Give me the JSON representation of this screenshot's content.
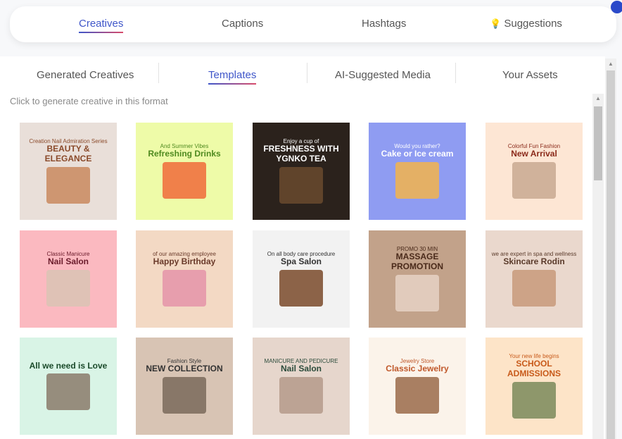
{
  "top_tabs": [
    {
      "label": "Creatives",
      "active": true
    },
    {
      "label": "Captions"
    },
    {
      "label": "Hashtags"
    },
    {
      "label": "Suggestions",
      "icon": "lightbulb-icon"
    }
  ],
  "sub_tabs": [
    {
      "label": "Generated Creatives"
    },
    {
      "label": "Templates",
      "active": true
    },
    {
      "label": "AI-Suggested Media"
    },
    {
      "label": "Your Assets"
    }
  ],
  "hint": "Click to generate creative in this format",
  "accent": "#3f56c9",
  "templates": [
    {
      "title": "BEAUTY & ELEGANCE",
      "sub": "Creation Nail Admiration Series",
      "bg": "#e9dfd9",
      "fg": "#8a4a2a",
      "ph": "#c98a5e"
    },
    {
      "title": "Refreshing Drinks",
      "sub": "And Summer Vibes",
      "bg": "#eefba8",
      "fg": "#4f8a1f",
      "ph": "#f06a3a"
    },
    {
      "title": "FRESHNESS WITH YGNKO TEA",
      "sub": "Enjoy a cup of",
      "bg": "#2b221c",
      "fg": "#ffffff",
      "ph": "#6a4a2e"
    },
    {
      "title": "Cake or Ice cream",
      "sub": "Would you rather?",
      "bg": "#8f9cf2",
      "fg": "#ffffff",
      "ph": "#f3b44c"
    },
    {
      "title": "New Arrival",
      "sub": "Colorful Fun Fashion",
      "bg": "#fde6d4",
      "fg": "#8a2a1a",
      "ph": "#c8a890"
    },
    {
      "title": "Nail Salon",
      "sub": "Classic Manicure",
      "bg": "#fbb9c0",
      "fg": "#6a1a2a",
      "ph": "#d9c3b4"
    },
    {
      "title": "Happy Birthday",
      "sub": "of our amazing employee",
      "bg": "#f3d9c4",
      "fg": "#6a3a2a",
      "ph": "#e493a9"
    },
    {
      "title": "Spa Salon",
      "sub": "On all body care procedure",
      "bg": "#f2f2f2",
      "fg": "#333333",
      "ph": "#7a4a2a"
    },
    {
      "title": "MASSAGE PROMOTION",
      "sub": "PROMO 30 MIN",
      "bg": "#c2a28a",
      "fg": "#4a2a1a",
      "ph": "#e6d2c4"
    },
    {
      "title": "Skincare Rodin",
      "sub": "we are expert in spa and wellness",
      "bg": "#ead8cd",
      "fg": "#5a3a2a",
      "ph": "#c89a7a"
    },
    {
      "title": "All we need is Love",
      "sub": "",
      "bg": "#d9f4e6",
      "fg": "#1a4a2a",
      "ph": "#8a7a6a"
    },
    {
      "title": "NEW COLLECTION",
      "sub": "Fashion Style",
      "bg": "#d8c4b4",
      "fg": "#333333",
      "ph": "#7a6a5a"
    },
    {
      "title": "Nail Salon",
      "sub": "MANICURE AND PEDICURE",
      "bg": "#e6d6cc",
      "fg": "#2a4a3a",
      "ph": "#b49a8a"
    },
    {
      "title": "Classic Jewelry",
      "sub": "Jewelry Store",
      "bg": "#fbf3ea",
      "fg": "#c0582a",
      "ph": "#9a6a4a"
    },
    {
      "title": "SCHOOL ADMISSIONS",
      "sub": "Your new life begins",
      "bg": "#fde4c8",
      "fg": "#c85a1a",
      "ph": "#7a8a5a"
    }
  ]
}
